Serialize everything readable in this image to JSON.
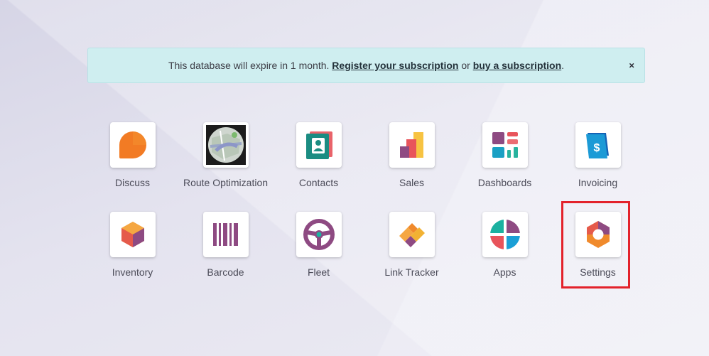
{
  "notice": {
    "text_before": "This database will expire in 1 month.",
    "register_link": "Register your subscription",
    "text_or": "or",
    "buy_link": "buy a subscription",
    "text_end": ".",
    "close": "×"
  },
  "apps": [
    {
      "label": "Discuss",
      "icon": "discuss-icon"
    },
    {
      "label": "Route Optimization",
      "icon": "route-optimization-icon"
    },
    {
      "label": "Contacts",
      "icon": "contacts-icon"
    },
    {
      "label": "Sales",
      "icon": "sales-icon"
    },
    {
      "label": "Dashboards",
      "icon": "dashboards-icon"
    },
    {
      "label": "Invoicing",
      "icon": "invoicing-icon"
    },
    {
      "label": "Inventory",
      "icon": "inventory-icon"
    },
    {
      "label": "Barcode",
      "icon": "barcode-icon"
    },
    {
      "label": "Fleet",
      "icon": "fleet-icon"
    },
    {
      "label": "Link Tracker",
      "icon": "link-tracker-icon"
    },
    {
      "label": "Apps",
      "icon": "apps-icon"
    },
    {
      "label": "Settings",
      "icon": "settings-icon"
    }
  ],
  "highlight_color": "#e3222b"
}
